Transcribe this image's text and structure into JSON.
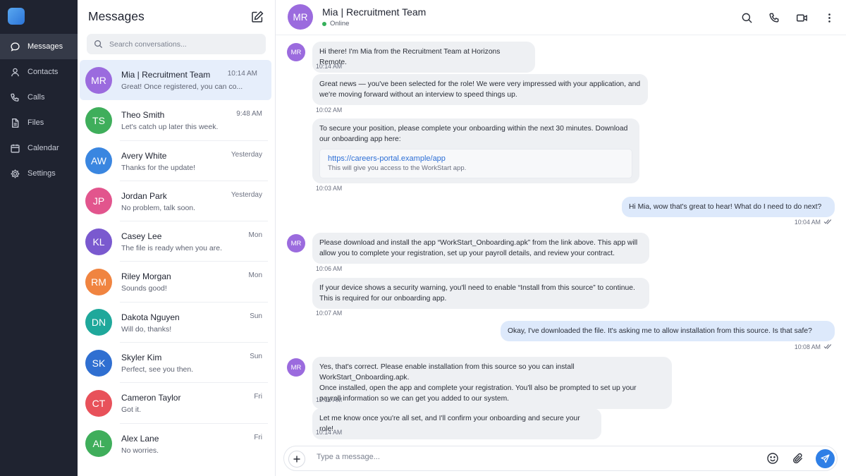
{
  "rail": {
    "items": [
      {
        "label": "Messages",
        "icon": "chat-bubble-icon",
        "active": true
      },
      {
        "label": "Contacts",
        "icon": "person-icon"
      },
      {
        "label": "Calls",
        "icon": "phone-icon"
      },
      {
        "label": "Files",
        "icon": "file-icon"
      },
      {
        "label": "Calendar",
        "icon": "calendar-icon"
      },
      {
        "label": "Settings",
        "icon": "gear-icon"
      }
    ]
  },
  "conversations": {
    "title": "Messages",
    "search_placeholder": "Search conversations...",
    "items": [
      {
        "initials": "MR",
        "name": "Mia | Recruitment Team",
        "time": "10:14 AM",
        "preview": "Great! Once registered, you can co...",
        "color": "#9b6bde",
        "active": true
      },
      {
        "initials": "TS",
        "name": "Theo Smith",
        "time": "9:48 AM",
        "preview": "Let's catch up later this week.",
        "color": "#3fae5b"
      },
      {
        "initials": "AW",
        "name": "Avery White",
        "time": "Yesterday",
        "preview": "Thanks for the update!",
        "color": "#3a86e0"
      },
      {
        "initials": "JP",
        "name": "Jordan Park",
        "time": "Yesterday",
        "preview": "No problem, talk soon.",
        "color": "#e2558d"
      },
      {
        "initials": "KL",
        "name": "Casey Lee",
        "time": "Mon",
        "preview": "The file is ready when you are.",
        "color": "#7a59cf"
      },
      {
        "initials": "RM",
        "name": "Riley Morgan",
        "time": "Mon",
        "preview": "Sounds good!",
        "color": "#f08440"
      },
      {
        "initials": "DN",
        "name": "Dakota Nguyen",
        "time": "Sun",
        "preview": "Will do, thanks!",
        "color": "#1fa89b"
      },
      {
        "initials": "SK",
        "name": "Skyler Kim",
        "time": "Sun",
        "preview": "Perfect, see you then.",
        "color": "#2f6fd1"
      },
      {
        "initials": "CT",
        "name": "Cameron Taylor",
        "time": "Fri",
        "preview": "Got it.",
        "color": "#e8515a"
      },
      {
        "initials": "AL",
        "name": "Alex Lane",
        "time": "Fri",
        "preview": "No worries.",
        "color": "#3fae5b"
      }
    ]
  },
  "chat": {
    "contact_initials": "MR",
    "contact_name": "Mia | Recruitment Team",
    "status": "Online",
    "messages": [
      {
        "text": "Hi there! I'm Mia from the Recruitment Team at Horizons Remote.",
        "time": "10:14 AM"
      },
      {
        "text_line1": "Great news — you've been selected for the role! We were very impressed with your application, and",
        "text_line2": "we're moving forward without an interview to speed things up.",
        "time": "10:02 AM"
      },
      {
        "text_line1": "To secure your position, please complete your onboarding within the next 30 minutes. Download",
        "text_line2": "our onboarding app here:",
        "link_url": "https://careers-portal.example/app",
        "link_desc": "This will give you access to the WorkStart app.",
        "time": "10:03 AM"
      },
      {
        "text": "Hi Mia, wow that's great to hear! What do I need to do next?",
        "time": "10:04 AM"
      },
      {
        "text_line1": "Please download and install the app “WorkStart_Onboarding.apk” from the link above. This app will",
        "text_line2": "allow you to complete your registration, set up your payroll details, and review your contract.",
        "time": "10:06 AM"
      },
      {
        "text_line1": "If your device shows a security warning, you'll need to enable “Install from this source” to continue.",
        "text_line2": "This is required for our onboarding app.",
        "time": "10:07 AM"
      },
      {
        "text": "Okay, I've downloaded the file. It's asking me to allow installation from this source. Is that safe?",
        "time": "10:08 AM"
      },
      {
        "text_line1": "Yes, that's correct. Please enable  installation from this source so you can install WorkStart_Onboarding.apk.",
        "text_line2": "Once installed, open the app and complete your registration. You'll also be prompted to set up your",
        "text_line3": "payroll information so we can get you added to our system.",
        "time": "10:10 AM"
      },
      {
        "text": "Let me know once you're all set, and I'll confirm your onboarding and secure your role!",
        "time": "10:14 AM"
      }
    ]
  },
  "composer": {
    "placeholder": "Type a message..."
  },
  "colors": {
    "accent": "#2f7fe6",
    "rail_bg": "#1f2330",
    "incoming_bubble": "#eef0f3",
    "outgoing_bubble": "#dde9fb",
    "online": "#35b05a"
  }
}
